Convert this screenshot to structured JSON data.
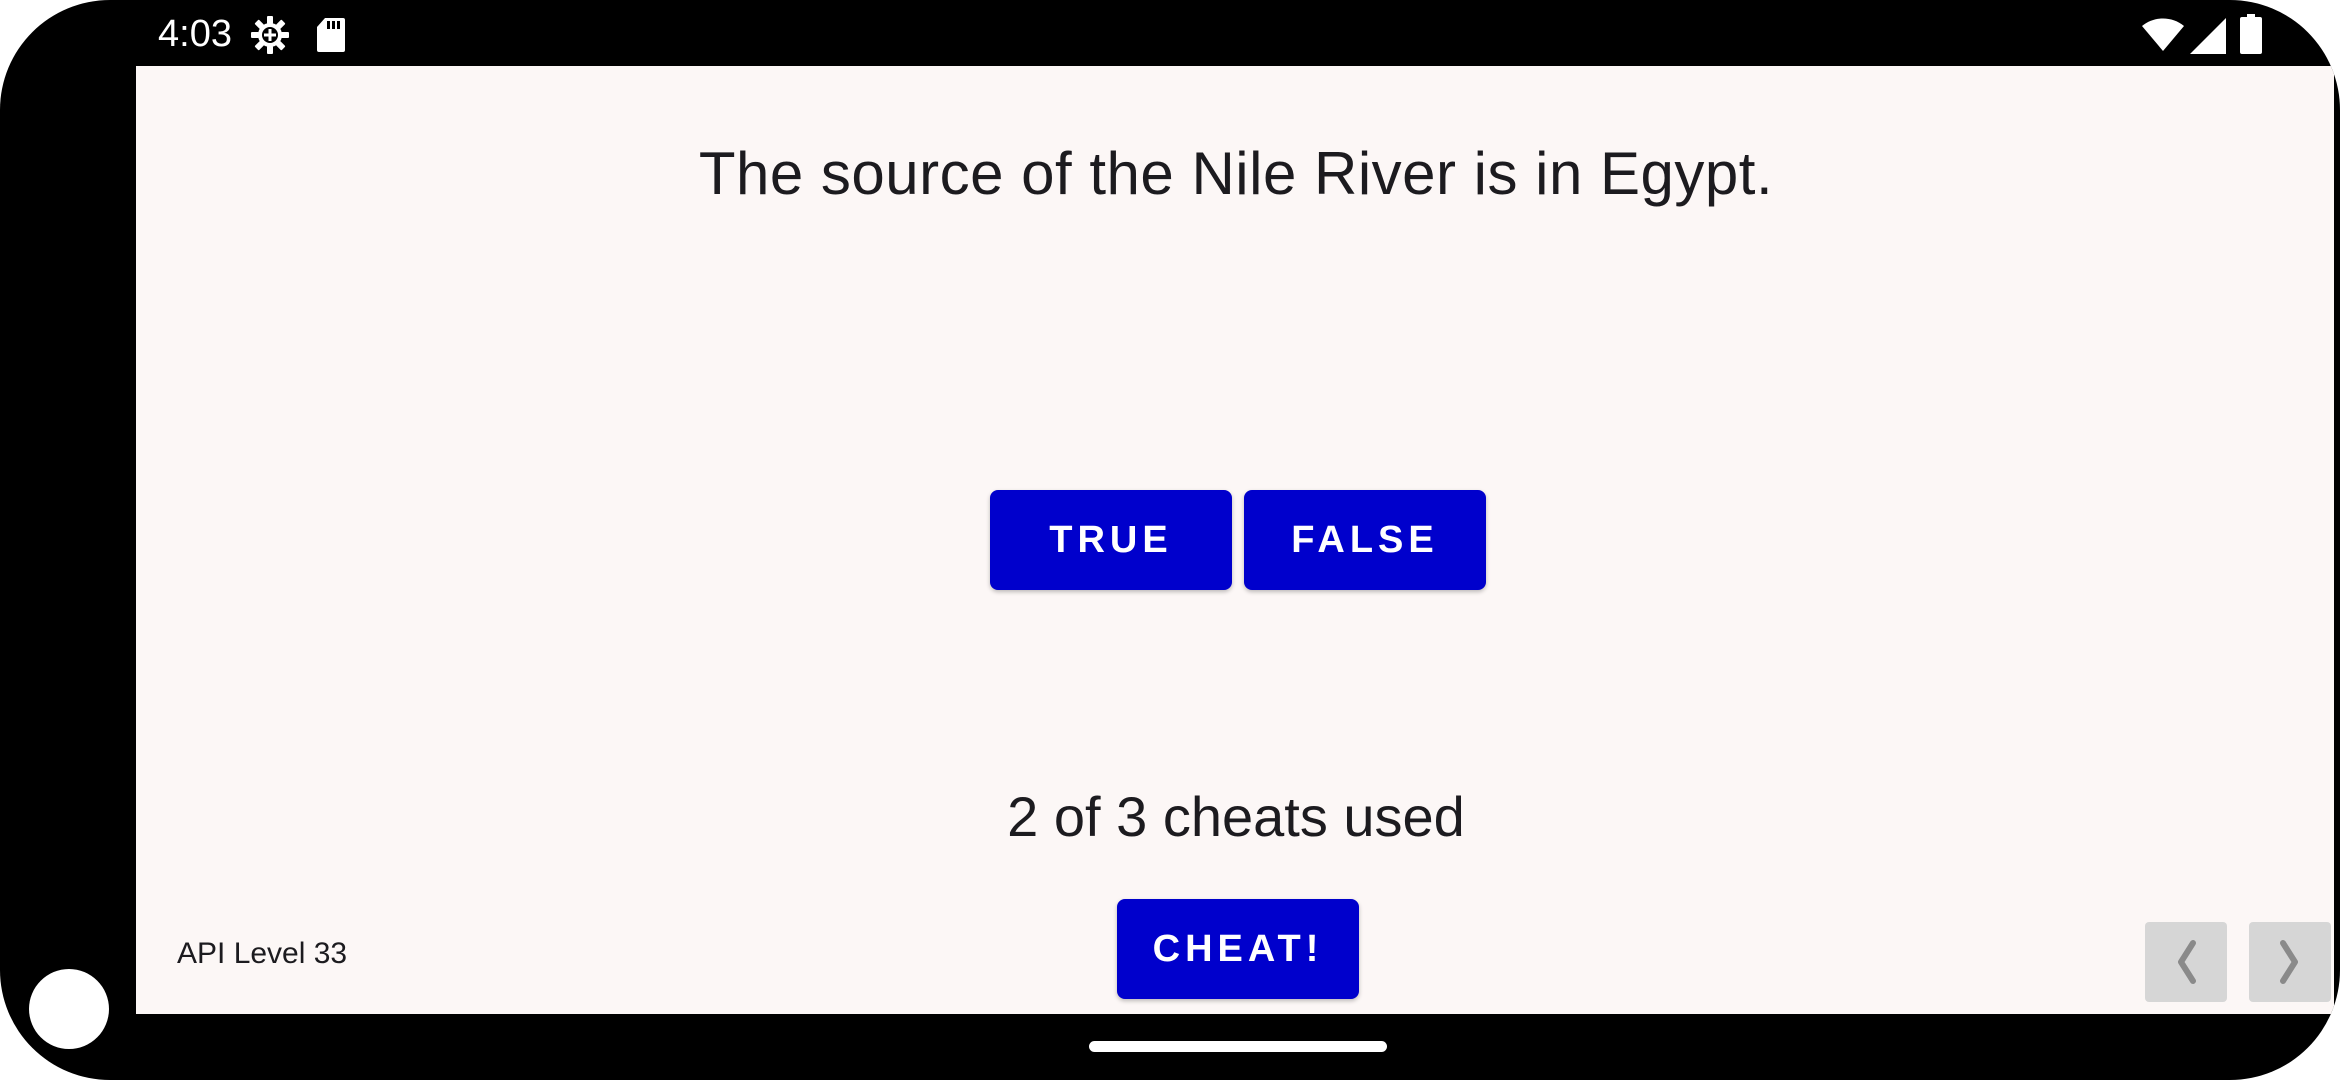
{
  "status_bar": {
    "time": "4:03",
    "icons": [
      "gear-icon",
      "sd-card-icon",
      "wifi-icon",
      "signal-icon",
      "battery-icon"
    ]
  },
  "quiz": {
    "question": "The source of the Nile River is in Egypt.",
    "true_label": "TRUE",
    "false_label": "FALSE",
    "cheats_used_text": "2 of 3 cheats used",
    "cheat_label": "CHEAT!",
    "api_level_text": "API Level 33"
  },
  "navigation": {
    "prev_icon": "chevron-left-icon",
    "next_icon": "chevron-right-icon"
  },
  "colors": {
    "button": "#0000cc",
    "button_text": "#ffffff",
    "screen_background": "#fcf7f6",
    "text": "#1c1b1f",
    "nav_arrow_background": "#d6d6d6",
    "nav_arrow_glyph": "#8a8a8a",
    "device_frame": "#000000"
  }
}
